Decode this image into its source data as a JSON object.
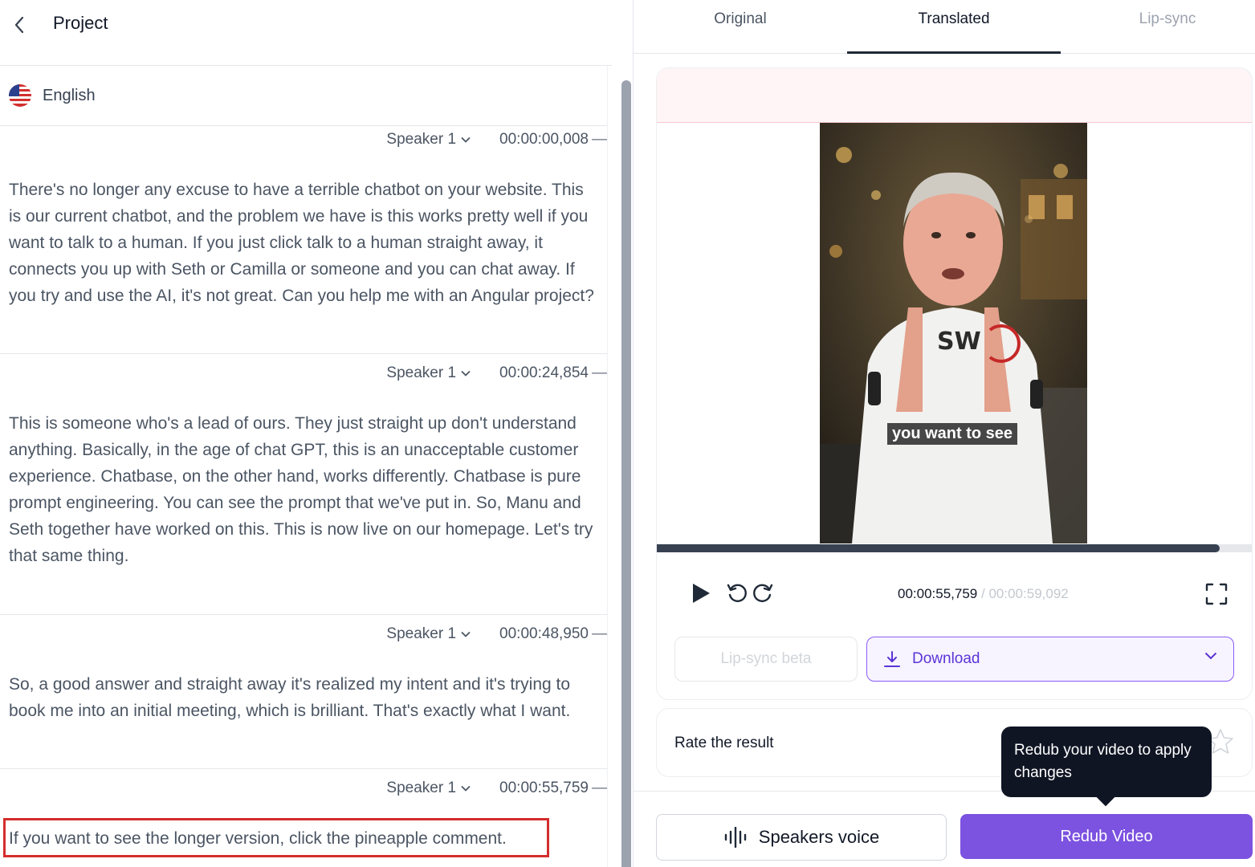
{
  "header": {
    "title": "Project"
  },
  "language": {
    "label": "English",
    "flag": "us-flag-icon"
  },
  "segments": [
    {
      "speaker": "Speaker 1",
      "time": "00:00:00,008",
      "text": "There's no longer any excuse to have a terrible chatbot on your website. This is our current chatbot, and the problem we have is this works pretty well if you want to talk to a human. If you just click talk to a human straight away, it connects you up with Seth or Camilla or someone and you can chat away. If you try and use the AI, it's not great. Can you help me with an Angular project?"
    },
    {
      "speaker": "Speaker 1",
      "time": "00:00:24,854",
      "text": "This is someone who's a lead of ours. They just straight up don't understand anything. Basically, in the age of chat GPT, this is an unacceptable customer experience. Chatbase, on the other hand, works differently. Chatbase is pure prompt engineering. You can see the prompt that we've put in. So, Manu and Seth together have worked on this. This is now live on our homepage. Let's try that same thing."
    },
    {
      "speaker": "Speaker 1",
      "time": "00:00:48,950",
      "text": "So, a good answer and straight away it's realized my intent and it's trying to book me into an initial meeting, which is brilliant. That's exactly what I want."
    },
    {
      "speaker": "Speaker 1",
      "time": "00:00:55,759",
      "text": "If you want to see the longer version, click the pineapple comment."
    }
  ],
  "tabs": {
    "original": "Original",
    "translated": "Translated",
    "lipsync": "Lip-sync"
  },
  "player": {
    "subtitle": "you want to see",
    "shirt_logo": "SW",
    "current_time": "00:00:55,759",
    "separator": "/",
    "total_time": "00:00:59,092",
    "progress": 0.944
  },
  "actions": {
    "lipsync_label": "Lip-sync beta",
    "download_label": "Download",
    "rate_label": "Rate the result",
    "speakers_voice_label": "Speakers voice",
    "redub_label": "Redub Video",
    "tooltip": "Redub your video to apply changes"
  },
  "colors": {
    "accent": "#7c52e0",
    "highlight": "#d42d2d",
    "tab_active": "#1f2937"
  }
}
